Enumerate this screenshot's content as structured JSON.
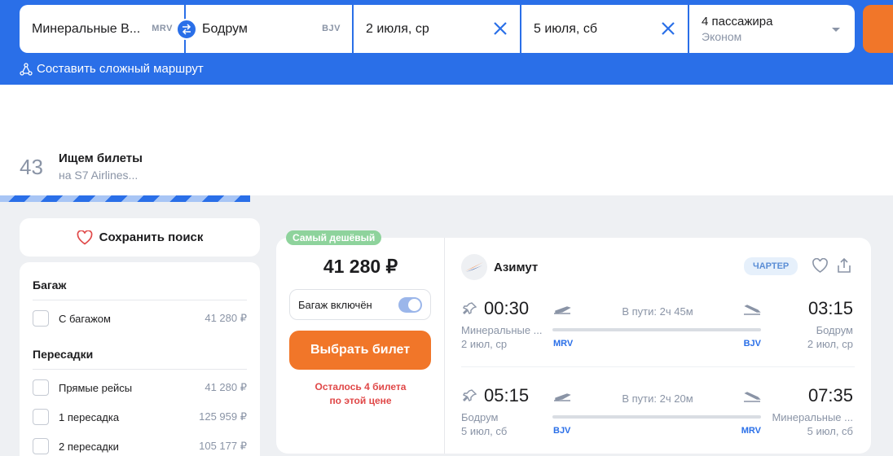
{
  "search": {
    "from_city": "Минеральные В...",
    "from_code": "MRV",
    "to_city": "Бодрум",
    "to_code": "BJV",
    "date_there": "2 июля, ср",
    "date_back": "5 июля, сб",
    "passengers": "4 пассажира",
    "cabin_class": "Эконом",
    "complex_route": "Составить сложный маршрут"
  },
  "searching": {
    "count": "43",
    "title": "Ищем билеты",
    "subtitle": "на S7 Airlines...",
    "progress": 0.28
  },
  "sidebar": {
    "save_search": "Сохранить поиск",
    "baggage_title": "Багаж",
    "baggage_items": [
      {
        "label": "С багажом",
        "price": "41 280 ₽"
      }
    ],
    "transfers_title": "Пересадки",
    "transfer_items": [
      {
        "label": "Прямые рейсы",
        "price": "41 280 ₽"
      },
      {
        "label": "1 пересадка",
        "price": "125 959 ₽"
      },
      {
        "label": "2 пересадки",
        "price": "105 177 ₽"
      }
    ]
  },
  "ticket": {
    "badge": "Самый дешёвый",
    "price": "41 280 ₽",
    "baggage_included": "Багаж включён",
    "baggage_on": true,
    "buy_label": "Выбрать билет",
    "seats_left_1": "Осталось 4 билета",
    "seats_left_2": "по этой цене",
    "airline": "Азимут",
    "charter": "ЧАРТЕР",
    "segments": [
      {
        "dep_time": "00:30",
        "arr_time": "03:15",
        "dep_city": "Минеральные ...",
        "arr_city": "Бодрум",
        "dep_date": "2 июл, ср",
        "arr_date": "2 июл, ср",
        "duration": "В пути: 2ч 45м",
        "dep_code": "MRV",
        "arr_code": "BJV"
      },
      {
        "dep_time": "05:15",
        "arr_time": "07:35",
        "dep_city": "Бодрум",
        "arr_city": "Минеральные ...",
        "dep_date": "5 июл, сб",
        "arr_date": "5 июл, сб",
        "duration": "В пути: 2ч 20м",
        "dep_code": "BJV",
        "arr_code": "MRV"
      }
    ]
  },
  "colors": {
    "brand_blue": "#2a6fe8",
    "accent_orange": "#f17629",
    "cheapest_green": "#8ed39c",
    "warning_red": "#e04848"
  }
}
